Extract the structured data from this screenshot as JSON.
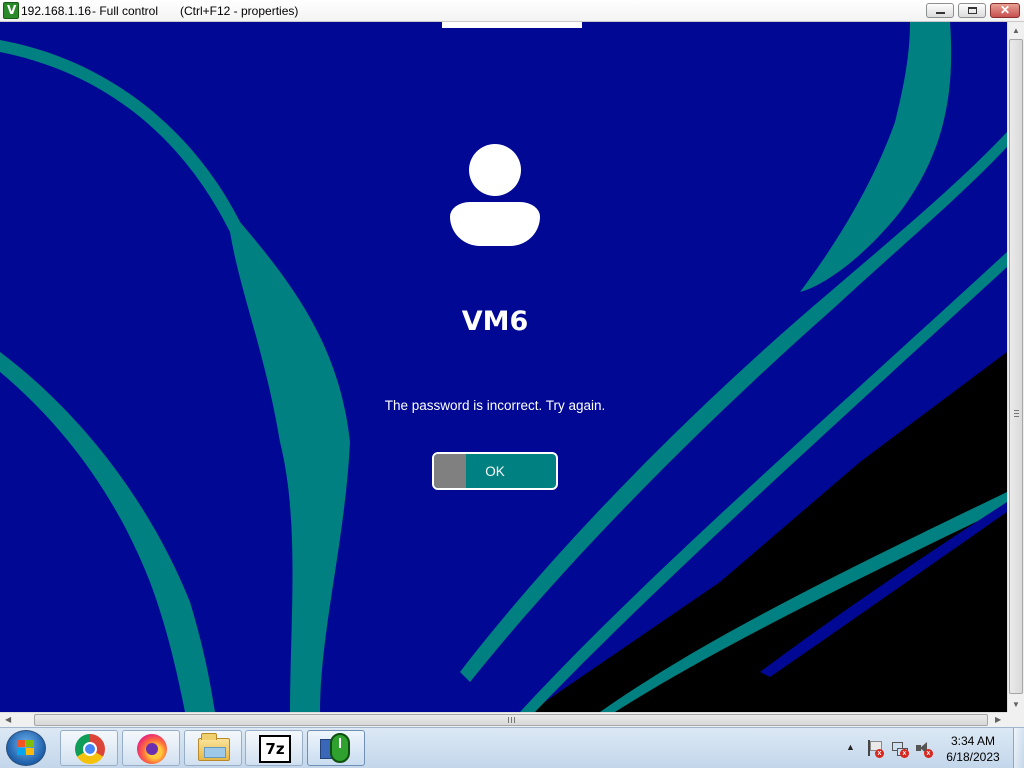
{
  "window": {
    "host": "192.168.1.16",
    "mode": "- Full control",
    "hint": "(Ctrl+F12 - properties)",
    "app_icon": "remote-control-icon",
    "buttons": [
      "minimize",
      "maximize",
      "close"
    ]
  },
  "remote_screen": {
    "username": "VM6",
    "message": "The password is incorrect. Try again.",
    "ok_label": "OK",
    "colors": {
      "background": "#000894",
      "teal": "#008080",
      "black": "#000000",
      "text": "#ffffff"
    }
  },
  "taskbar": {
    "start": "windows-start-icon",
    "pinned": [
      {
        "name": "chrome",
        "icon": "chrome-icon"
      },
      {
        "name": "firefox",
        "icon": "firefox-icon"
      },
      {
        "name": "explorer",
        "icon": "folder-icon"
      },
      {
        "name": "7zip",
        "icon": "sevenzip-icon",
        "text": "7z"
      },
      {
        "name": "remote",
        "icon": "remote-control-icon",
        "active": true
      }
    ],
    "tray": {
      "icons": [
        "action-center-flag-icon",
        "network-icon",
        "volume-muted-icon"
      ],
      "time": "3:34 AM",
      "date": "6/18/2023"
    }
  }
}
